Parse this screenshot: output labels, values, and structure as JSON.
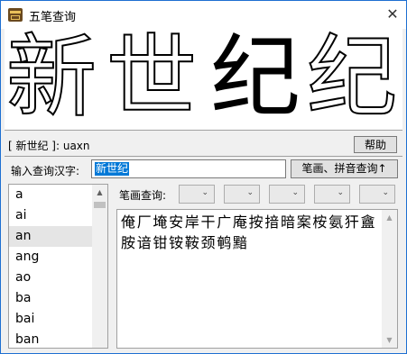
{
  "window": {
    "title": "五笔查询",
    "close_symbol": "✕"
  },
  "banner": {
    "glyphs": [
      "新",
      "世",
      "纪",
      "纪"
    ]
  },
  "code": {
    "text": "[ 新世纪 ]:  uaxn"
  },
  "toolbar": {
    "help_label": "帮助",
    "search_label": "笔画、拼音查询↑"
  },
  "input": {
    "label": "输入查询汉字:",
    "value": "新世纪"
  },
  "pinyin": {
    "items": [
      "a",
      "ai",
      "an",
      "ang",
      "ao",
      "ba",
      "bai",
      "ban"
    ],
    "selected": "an"
  },
  "strokes": {
    "label": "笔画查询:",
    "dropdown_arrow": "⌄"
  },
  "results": {
    "text": "俺厂埯安岸干广庵按揞暗案桉氨犴盦胺谙钳铵鞍颈鹌黯"
  },
  "scroll": {
    "up": "▲",
    "down": "▼"
  }
}
